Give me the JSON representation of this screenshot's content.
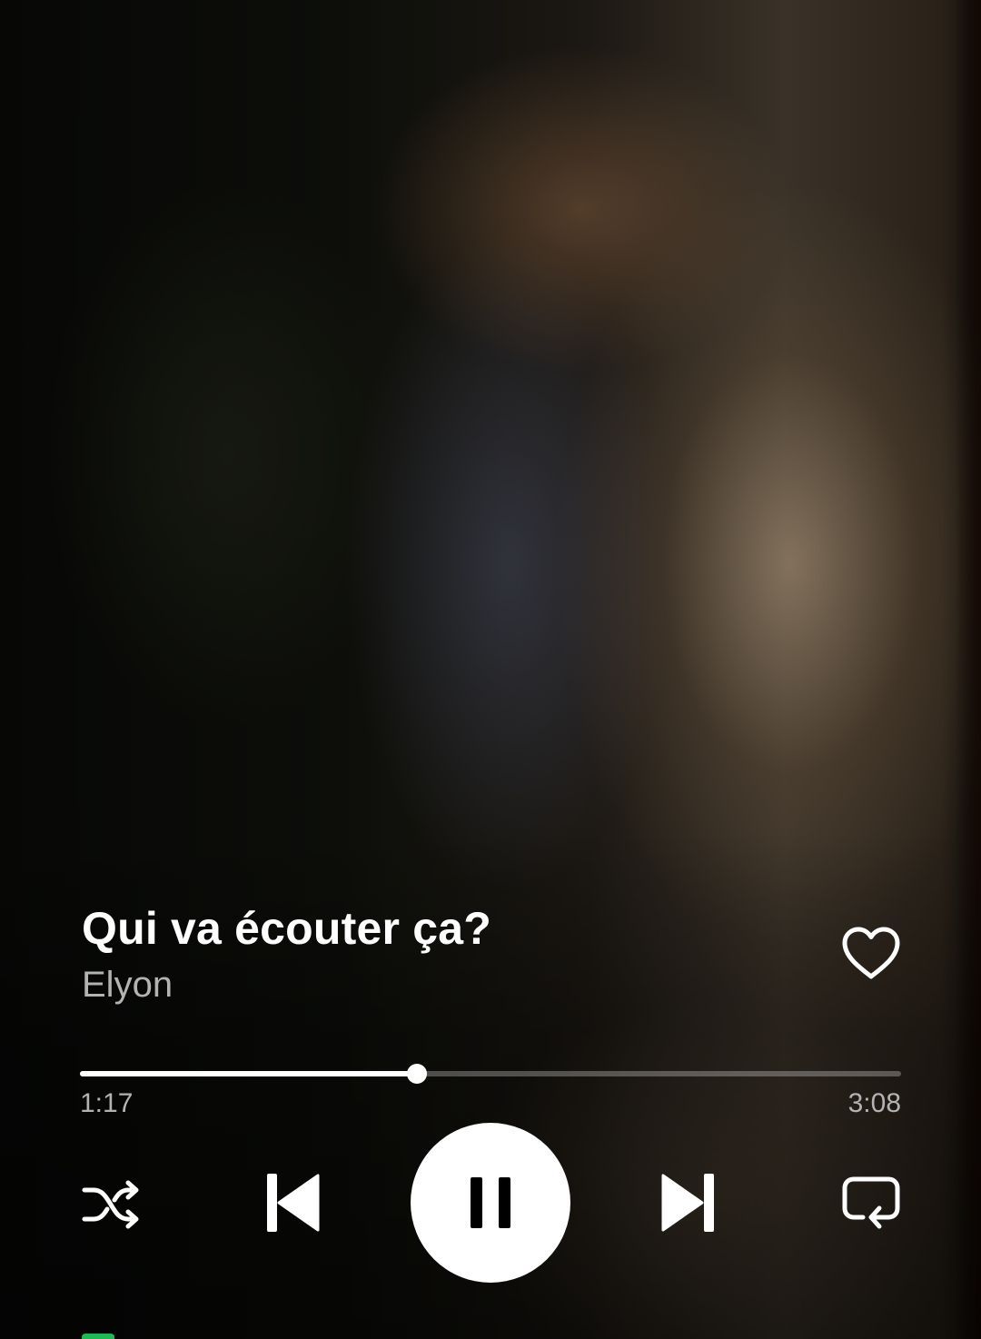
{
  "track": {
    "title": "Qui va écouter ça?",
    "artist": "Elyon",
    "liked": false
  },
  "playback": {
    "elapsed": "1:17",
    "duration": "3:08",
    "progress_fraction": 0.41,
    "state": "playing"
  },
  "controls": {
    "shuffle_icon": "shuffle-icon",
    "previous_icon": "skip-previous-icon",
    "play_pause_icon": "pause-icon",
    "next_icon": "skip-next-icon",
    "repeat_icon": "repeat-icon",
    "like_icon": "heart-outline-icon"
  },
  "colors": {
    "primary_text": "#ffffff",
    "secondary_text": "#b3b3b3",
    "accent": "#1db954"
  }
}
